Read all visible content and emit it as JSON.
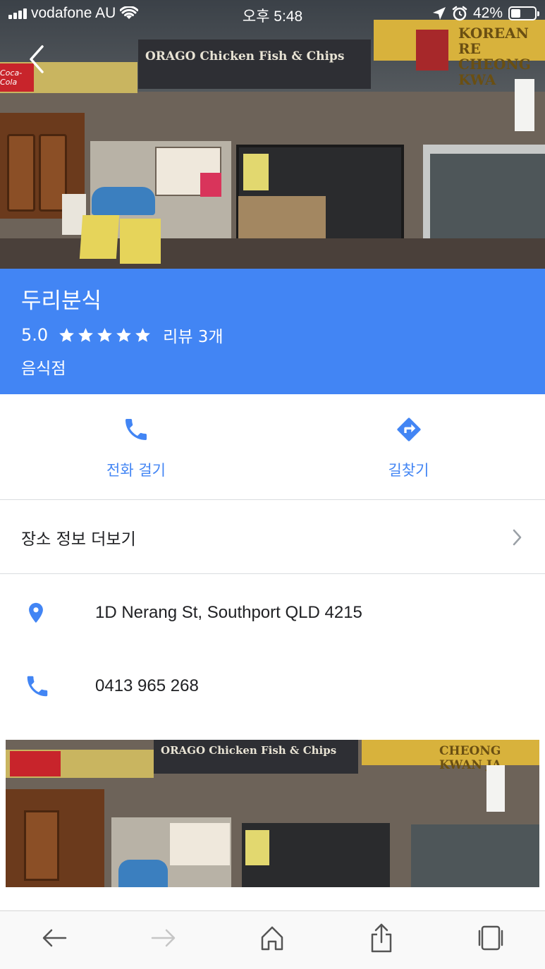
{
  "status_bar": {
    "carrier": "vodafone AU",
    "time": "오후 5:48",
    "battery_percent": "42%",
    "battery_level": 0.42
  },
  "hero_photo": {
    "signs": {
      "coke": "Coca-Cola",
      "shop": "ORAGO Chicken Fish & Chips",
      "right": "KOREAN RE\nCHEONG KWA"
    }
  },
  "place": {
    "name": "두리분식",
    "rating": "5.0",
    "stars": 5,
    "reviews": "리뷰 3개",
    "category": "음식점"
  },
  "actions": {
    "call_label": "전화 걸기",
    "directions_label": "길찾기"
  },
  "more_info": {
    "label": "장소 정보 더보기"
  },
  "details": {
    "address": "1D Nerang St, Southport QLD 4215",
    "phone": "0413 965 268"
  },
  "photo2": {
    "signs": {
      "shop": "ORAGO Chicken Fish & Chips",
      "right": "CHEONG KWAN JA"
    }
  },
  "colors": {
    "accent": "#4285f4",
    "text": "#202124",
    "divider": "#dadce0"
  },
  "icons": {
    "back": "chevron-left-icon",
    "call": "phone-icon",
    "directions": "directions-icon",
    "chevron": "chevron-right-icon",
    "address": "location-pin-icon",
    "phone": "phone-icon",
    "toolbar": [
      "back-arrow-icon",
      "forward-arrow-icon",
      "home-icon",
      "share-icon",
      "tabs-icon"
    ]
  }
}
